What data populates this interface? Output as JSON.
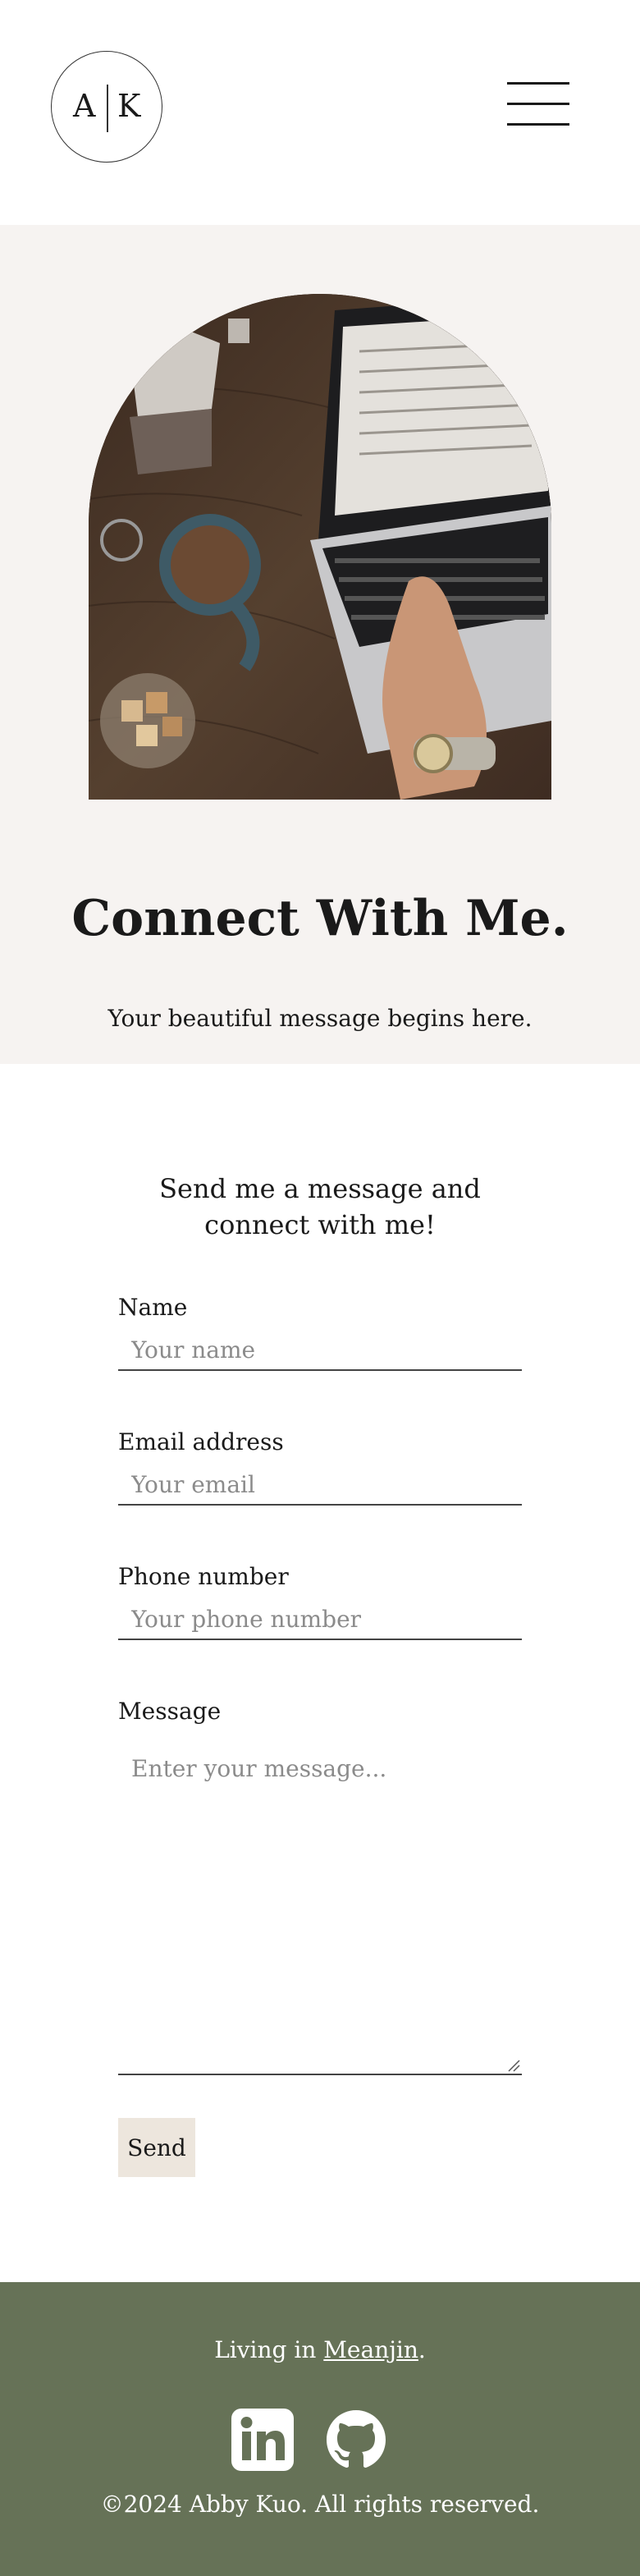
{
  "header": {
    "logo_left": "A",
    "logo_right": "K",
    "menu_icon": "hamburger-menu-icon"
  },
  "hero": {
    "image_icon": "laptop-desk-photo",
    "title": "Connect With Me.",
    "subtitle": "Your beautiful message begins here."
  },
  "form": {
    "intro": "Send me a message and connect with me!",
    "name_label": "Name",
    "name_placeholder": "Your name",
    "email_label": "Email address",
    "email_placeholder": "Your email",
    "phone_label": "Phone number",
    "phone_placeholder": "Your phone number",
    "message_label": "Message",
    "message_placeholder": "Enter your message...",
    "send_label": "Send"
  },
  "footer": {
    "living_prefix": "Living in ",
    "living_link": "Meanjin",
    "living_suffix": ".",
    "linkedin_icon": "linkedin-icon",
    "github_icon": "github-icon",
    "copyright": "©2024 Abby Kuo. All rights reserved."
  },
  "colors": {
    "hero_bg": "#f6f3f1",
    "footer_bg": "#667257",
    "button_bg": "#ede6dd",
    "text": "#1a1a1a"
  }
}
